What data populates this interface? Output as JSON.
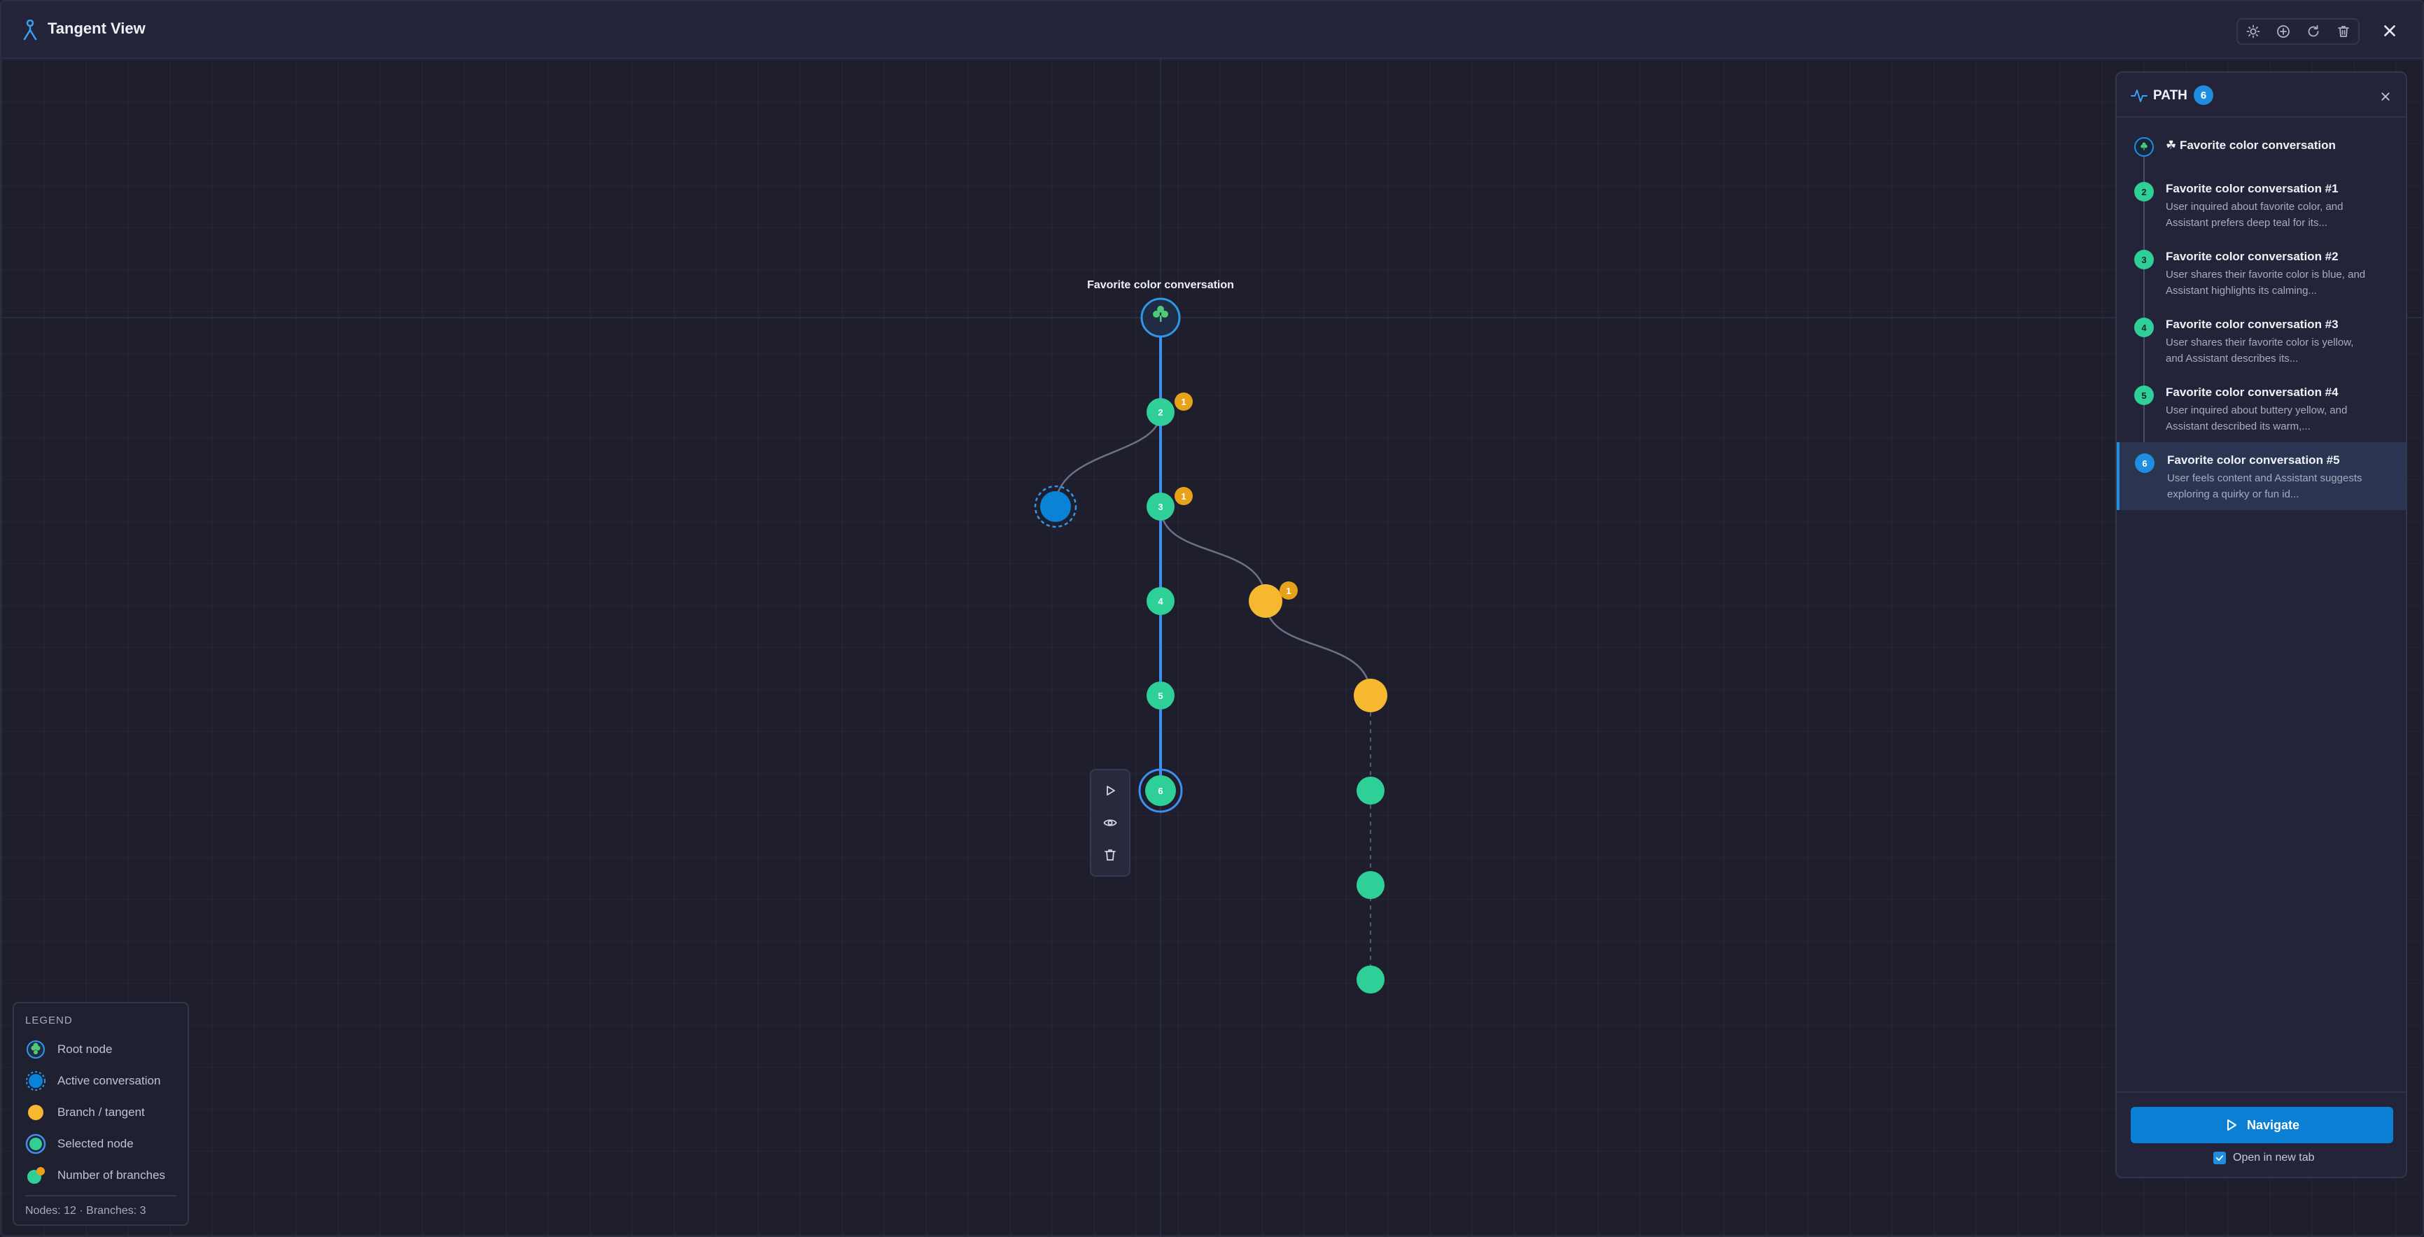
{
  "app": {
    "title": "Tangent View",
    "toolbar": [
      "sun-icon",
      "plus-circle-icon",
      "refresh-icon",
      "trash-icon"
    ],
    "close_icon": "close-icon"
  },
  "graph": {
    "root_label": "Favorite color conversation",
    "nodes": [
      {
        "id": "root",
        "type": "root"
      },
      {
        "id": "n2",
        "label": "2",
        "branches": "1"
      },
      {
        "id": "n3",
        "label": "3",
        "branches": "1"
      },
      {
        "id": "n4",
        "label": "4"
      },
      {
        "id": "n5",
        "label": "5"
      },
      {
        "id": "n6",
        "label": "6",
        "selected": true
      },
      {
        "id": "active",
        "type": "active"
      },
      {
        "id": "b1",
        "type": "branch",
        "branches": "1"
      },
      {
        "id": "b2",
        "type": "branch"
      },
      {
        "id": "c1"
      },
      {
        "id": "c2"
      },
      {
        "id": "c3"
      }
    ]
  },
  "node_menu": [
    "play-icon",
    "eye-icon",
    "trash-icon"
  ],
  "legend": {
    "title": "LEGEND",
    "items": [
      "Root node",
      "Active conversation",
      "Branch / tangent",
      "Selected node",
      "Number of branches"
    ],
    "stats": "Nodes: 12 · Branches: 3"
  },
  "path_panel": {
    "title": "PATH",
    "count": "6",
    "items": [
      {
        "num": "",
        "title": "☘ Favorite color conversation",
        "sub": ""
      },
      {
        "num": "2",
        "title": "Favorite color conversation #1",
        "sub": "User inquired about favorite color, and Assistant prefers deep teal for its..."
      },
      {
        "num": "3",
        "title": "Favorite color conversation #2",
        "sub": "User shares their favorite color is blue, and Assistant highlights its calming..."
      },
      {
        "num": "4",
        "title": "Favorite color conversation #3",
        "sub": "User shares their favorite color is yellow, and Assistant describes its..."
      },
      {
        "num": "5",
        "title": "Favorite color conversation #4",
        "sub": "User inquired about buttery yellow, and Assistant described its warm,..."
      },
      {
        "num": "6",
        "title": "Favorite color conversation #5",
        "sub": "User feels content and Assistant suggests exploring a quirky or fun id..."
      }
    ],
    "navigate_label": "Navigate",
    "open_new_tab_label": "Open in new tab",
    "open_new_tab_checked": true
  },
  "colors": {
    "accent": "#1f8ee0",
    "node_green": "#2fcf98",
    "branch_yellow": "#f5b82e",
    "badge": "#e8a21a",
    "background": "#1e1e2c"
  }
}
